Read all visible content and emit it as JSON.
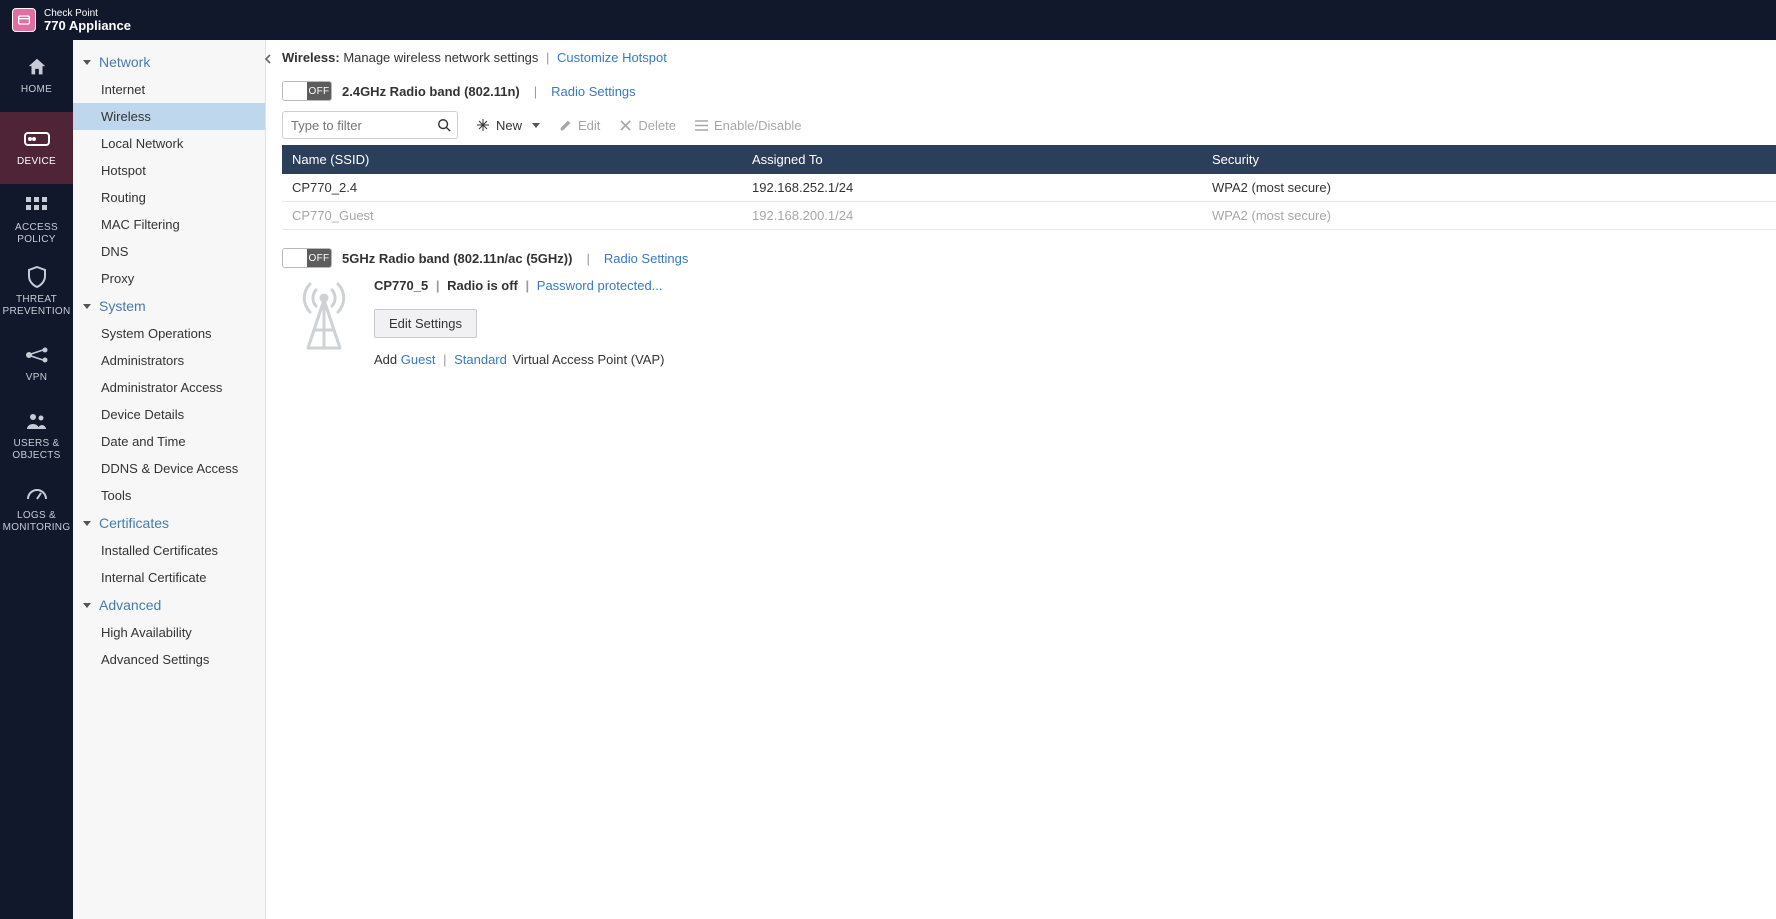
{
  "brand": {
    "top": "Check Point",
    "bottom": "770 Appliance"
  },
  "primaryNav": [
    {
      "id": "home",
      "label1": "HOME"
    },
    {
      "id": "device",
      "label1": "DEVICE",
      "active": true
    },
    {
      "id": "access",
      "label1": "ACCESS",
      "label2": "POLICY"
    },
    {
      "id": "threat",
      "label1": "THREAT",
      "label2": "PREVENTION"
    },
    {
      "id": "vpn",
      "label1": "VPN"
    },
    {
      "id": "users",
      "label1": "USERS &",
      "label2": "OBJECTS"
    },
    {
      "id": "logs",
      "label1": "LOGS &",
      "label2": "MONITORING"
    }
  ],
  "sidebar": {
    "groups": [
      {
        "title": "Network",
        "items": [
          {
            "label": "Internet"
          },
          {
            "label": "Wireless",
            "active": true
          },
          {
            "label": "Local Network"
          },
          {
            "label": "Hotspot"
          },
          {
            "label": "Routing"
          },
          {
            "label": "MAC Filtering"
          },
          {
            "label": "DNS"
          },
          {
            "label": "Proxy"
          }
        ]
      },
      {
        "title": "System",
        "items": [
          {
            "label": "System Operations"
          },
          {
            "label": "Administrators"
          },
          {
            "label": "Administrator Access"
          },
          {
            "label": "Device Details"
          },
          {
            "label": "Date and Time"
          },
          {
            "label": "DDNS & Device Access"
          },
          {
            "label": "Tools"
          }
        ]
      },
      {
        "title": "Certificates",
        "items": [
          {
            "label": "Installed Certificates"
          },
          {
            "label": "Internal Certificate"
          }
        ]
      },
      {
        "title": "Advanced",
        "items": [
          {
            "label": "High Availability"
          },
          {
            "label": "Advanced Settings"
          }
        ]
      }
    ]
  },
  "page": {
    "title": "Wireless:",
    "subtitle": "Manage wireless network settings",
    "customize_link": "Customize Hotspot"
  },
  "band24": {
    "toggle": "OFF",
    "title": "2.4GHz Radio band (802.11n)",
    "radio_settings": "Radio Settings",
    "filter_placeholder": "Type to filter",
    "actions": {
      "new": "New",
      "edit": "Edit",
      "delete": "Delete",
      "enable_disable": "Enable/Disable"
    },
    "columns": {
      "ssid": "Name (SSID)",
      "assigned": "Assigned To",
      "security": "Security"
    },
    "rows": [
      {
        "ssid": "CP770_2.4",
        "assigned": "192.168.252.1/24",
        "security": "WPA2 (most secure)"
      },
      {
        "ssid": "CP770_Guest",
        "assigned": "192.168.200.1/24",
        "security": "WPA2 (most secure)",
        "dimmed": true
      }
    ]
  },
  "band5": {
    "toggle": "OFF",
    "title": "5GHz Radio band (802.11n/ac (5GHz))",
    "radio_settings": "Radio Settings",
    "status_name": "CP770_5",
    "status_mid": "Radio is off",
    "password_link": "Password protected...",
    "edit_button": "Edit Settings",
    "add_text": "Add",
    "guest_link": "Guest",
    "standard_link": "Standard",
    "vap_text": "Virtual Access Point (VAP)"
  }
}
